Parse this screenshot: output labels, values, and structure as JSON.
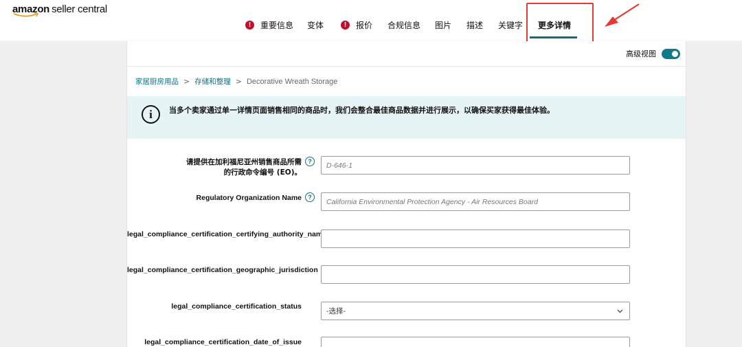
{
  "brand": {
    "amazon": "amazon",
    "seller_central": "seller central"
  },
  "tabs": [
    {
      "label": "重要信息",
      "error": true
    },
    {
      "label": "变体",
      "error": false
    },
    {
      "label": "报价",
      "error": true
    },
    {
      "label": "合规信息",
      "error": false
    },
    {
      "label": "图片",
      "error": false
    },
    {
      "label": "描述",
      "error": false
    },
    {
      "label": "关键字",
      "error": false
    },
    {
      "label": "更多详情",
      "error": false,
      "active": true
    }
  ],
  "advanced_view": {
    "label": "高级视图",
    "enabled": true
  },
  "breadcrumb": {
    "items": [
      "家居厨房用品",
      "存储和整理"
    ],
    "current": "Decorative Wreath Storage",
    "separator": ">"
  },
  "banner": {
    "text": "当多个卖家通过单一详情页面销售相同的商品时，我们会整合最佳商品数据并进行展示，以确保买家获得最佳体验。",
    "icon_glyph": "i"
  },
  "fields": [
    {
      "label_line1": "请提供在加利福尼亚州销售商品所需",
      "label_line2": "的行政命令编号 (EO)。",
      "help": true,
      "placeholder": "D-646-1",
      "value": ""
    },
    {
      "label": "Regulatory Organization Name",
      "help": true,
      "placeholder": "California Environmental Protection Agency - Air Resources Board",
      "value": ""
    },
    {
      "label": "legal_compliance_certification_certifying_authority_name",
      "help": false,
      "placeholder": "",
      "value": ""
    },
    {
      "label": "legal_compliance_certification_geographic_jurisdiction",
      "help": false,
      "placeholder": "",
      "value": ""
    },
    {
      "label": "legal_compliance_certification_status",
      "help": false,
      "type": "select",
      "value": "-选择-"
    },
    {
      "label": "legal_compliance_certification_date_of_issue",
      "help": false,
      "placeholder": "",
      "value": ""
    }
  ],
  "help_glyph": "?",
  "error_glyph": "!",
  "colors": {
    "accent": "#0f6f80",
    "error": "#c40d2e",
    "highlight": "#e53935",
    "banner": "#e7f4f5"
  }
}
